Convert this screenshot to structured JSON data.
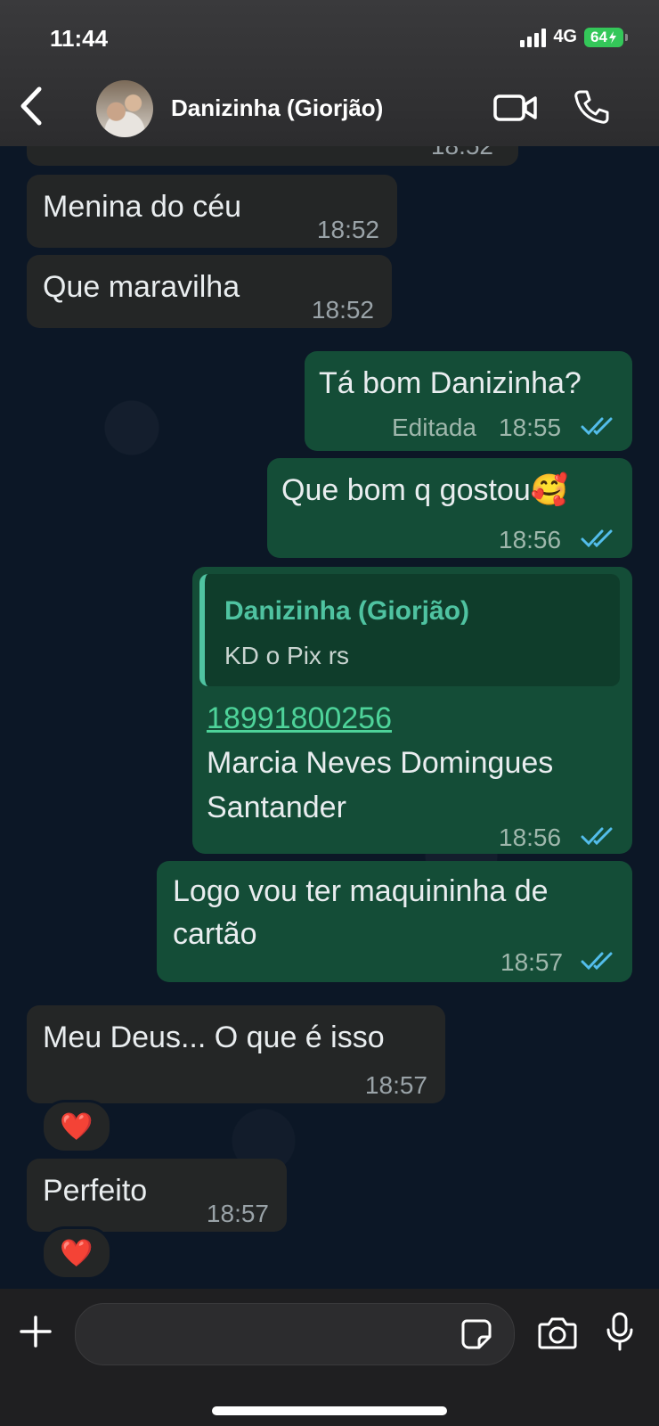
{
  "status_bar": {
    "time": "11:44",
    "network": "4G",
    "battery": "64"
  },
  "header": {
    "contact_name": "Danizinha (Giorjão)"
  },
  "messages": [
    {
      "direction": "in",
      "partial_time": "18:52"
    },
    {
      "direction": "in",
      "text": "Menina do céu",
      "time": "18:52"
    },
    {
      "direction": "in",
      "text": "Que maravilha",
      "time": "18:52"
    },
    {
      "direction": "out",
      "text": "Tá bom Danizinha?",
      "edited_label": "Editada",
      "time": "18:55",
      "read": true
    },
    {
      "direction": "out",
      "text": "Que bom q gostou🥰",
      "time": "18:56",
      "read": true
    },
    {
      "direction": "out",
      "quote_name": "Danizinha (Giorjão)",
      "quote_text": "KD o Pix rs",
      "link": "18991800256",
      "lines": [
        "Marcia Neves Domingues",
        "Santander"
      ],
      "time": "18:56",
      "read": true
    },
    {
      "direction": "out",
      "lines": [
        "Logo vou ter maquininha de",
        "cartão"
      ],
      "time": "18:57",
      "read": true
    },
    {
      "direction": "in",
      "text": "Meu Deus... O que é isso",
      "time": "18:57",
      "reaction": "❤️"
    },
    {
      "direction": "in",
      "text": "Perfeito",
      "time": "18:57",
      "reaction": "❤️"
    }
  ],
  "composer": {
    "placeholder": ""
  },
  "icons": [
    "back-chevron-icon",
    "video-call-icon",
    "voice-call-icon",
    "plus-icon",
    "sticker-icon",
    "camera-icon",
    "microphone-icon",
    "double-check-icon"
  ],
  "colors": {
    "incoming": "#242626",
    "outgoing": "#144d37",
    "read_ticks": "#53bdeb",
    "link": "#4ed39a",
    "quote_accent": "#4fc3a1"
  }
}
